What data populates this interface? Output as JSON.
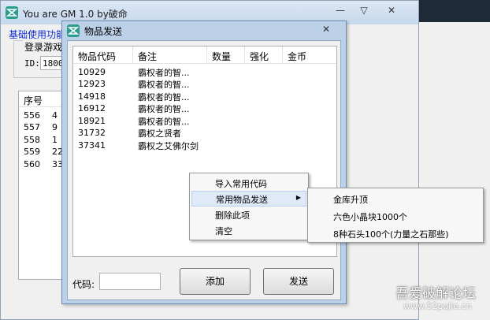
{
  "main_window": {
    "title": "You are GM 1.0 by破命",
    "minimize": "—",
    "maximize": "▽",
    "close": "✕",
    "tab": "基础使用功能",
    "login_group_label": "登录游戏",
    "id_label": "ID:",
    "id_value": "1800",
    "list_header": "序号",
    "rows": [
      {
        "seq": "556",
        "extra": "4"
      },
      {
        "seq": "557",
        "extra": "9"
      },
      {
        "seq": "558",
        "extra": "1"
      },
      {
        "seq": "559",
        "extra": "22"
      },
      {
        "seq": "560",
        "extra": "33"
      }
    ]
  },
  "dialog": {
    "title": "物品发送",
    "close": "✕",
    "columns": [
      "物品代码",
      "备注",
      "数量",
      "强化",
      "金币"
    ],
    "rows": [
      {
        "code": "10929",
        "note": "霸权者的智..."
      },
      {
        "code": "12923",
        "note": "霸权者的智..."
      },
      {
        "code": "14918",
        "note": "霸权者的智..."
      },
      {
        "code": "16912",
        "note": "霸权者的智..."
      },
      {
        "code": "18921",
        "note": "霸权者的智..."
      },
      {
        "code": "31732",
        "note": "霸权之贤者"
      },
      {
        "code": "37341",
        "note": "霸权之艾佛尔剑"
      }
    ],
    "code_label": "代码:",
    "code_value": "",
    "add_button": "添加",
    "send_button": "发送"
  },
  "context_menu": {
    "items": [
      "导入常用代码",
      "常用物品发送",
      "删除此项",
      "清空"
    ],
    "submenu_arrow": "▶",
    "submenu": [
      "金库升顶",
      "六色小晶块1000个",
      "8种石头100个(力量之石那些)"
    ]
  },
  "watermark": {
    "title": "吾爱破解论坛",
    "url": "www.52pojie.cn"
  }
}
